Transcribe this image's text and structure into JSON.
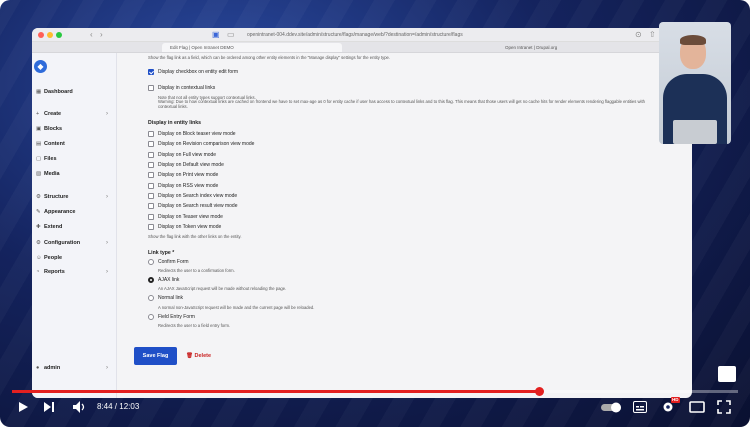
{
  "browser": {
    "url": "openintranet-004.ddev.site/admin/structure/flags/manage/web/?destination=/admin/structure/flags",
    "tabs": [
      {
        "label": "Edit Flag | Open Intranet DEMO"
      },
      {
        "label": "Open Intranet | Drupal.org"
      }
    ]
  },
  "sidebar": {
    "logo_glyph": "◆",
    "items": [
      {
        "label": "Dashboard",
        "icon": "dashboard-icon",
        "glyph": "▦"
      },
      {
        "label": "Create",
        "icon": "plus-icon",
        "glyph": "+"
      },
      {
        "label": "Blocks",
        "icon": "blocks-icon",
        "glyph": "▣"
      },
      {
        "label": "Content",
        "icon": "document-icon",
        "glyph": "▤"
      },
      {
        "label": "Files",
        "icon": "file-icon",
        "glyph": "▢"
      },
      {
        "label": "Media",
        "icon": "media-icon",
        "glyph": "▧"
      },
      {
        "label": "Structure",
        "icon": "structure-icon",
        "glyph": "⚙"
      },
      {
        "label": "Appearance",
        "icon": "brush-icon",
        "glyph": "✎"
      },
      {
        "label": "Extend",
        "icon": "puzzle-icon",
        "glyph": "✚"
      },
      {
        "label": "Configuration",
        "icon": "gear-icon",
        "glyph": "⚙"
      },
      {
        "label": "People",
        "icon": "person-icon",
        "glyph": "☺"
      },
      {
        "label": "Reports",
        "icon": "chart-icon",
        "glyph": "◔"
      },
      {
        "label": "admin",
        "icon": "user-icon",
        "glyph": "●"
      }
    ],
    "chevron": "›"
  },
  "form": {
    "top_description": "Show the flag link as a field, which can be ordered among other entity elements in the \"Manage display\" settings for the entity type.",
    "display_checkbox": "Display checkbox on entity edit form",
    "contextual_label": "Display in contextual links",
    "contextual_note": "Note that not all entity types support contextual links.",
    "contextual_warning": "Warning: Due to how contextual links are cached on frontend we have to set max-age as 0 for entity cache if user has access to contextual links and to this flag. This means that those users will get no cache hits for render elements rendering flaggable entities with contextual links.",
    "entity_links_heading": "Display in entity links",
    "view_modes": [
      "Display on Block teaser view mode",
      "Display on Revision comparison view mode",
      "Display on Full view mode",
      "Display on Default view mode",
      "Display on Print view mode",
      "Display on RSS view mode",
      "Display on Search index view mode",
      "Display on Search result view mode",
      "Display on Teaser view mode",
      "Display on Token view mode"
    ],
    "entity_links_description": "Show the flag link with the other links on the entity.",
    "link_type_heading": "Link type *",
    "link_types": [
      {
        "label": "Confirm Form",
        "desc": "Redirects the user to a confirmation form."
      },
      {
        "label": "AJAX link",
        "desc": "An AJAX JavaScript request will be made without reloading the page."
      },
      {
        "label": "Normal link",
        "desc": "A normal non-JavaScript request will be made and the current page will be reloaded."
      },
      {
        "label": "Field Entry Form",
        "desc": "Redirects the user to a field entry form."
      }
    ],
    "save_label": "Save Flag",
    "delete_label": "Delete"
  },
  "player": {
    "current_time": "8:44",
    "duration": "12:03",
    "progress": 0.726,
    "hd_badge": "HD",
    "colors": {
      "progress": "#e32020",
      "accent": "#1f4fc7"
    }
  }
}
